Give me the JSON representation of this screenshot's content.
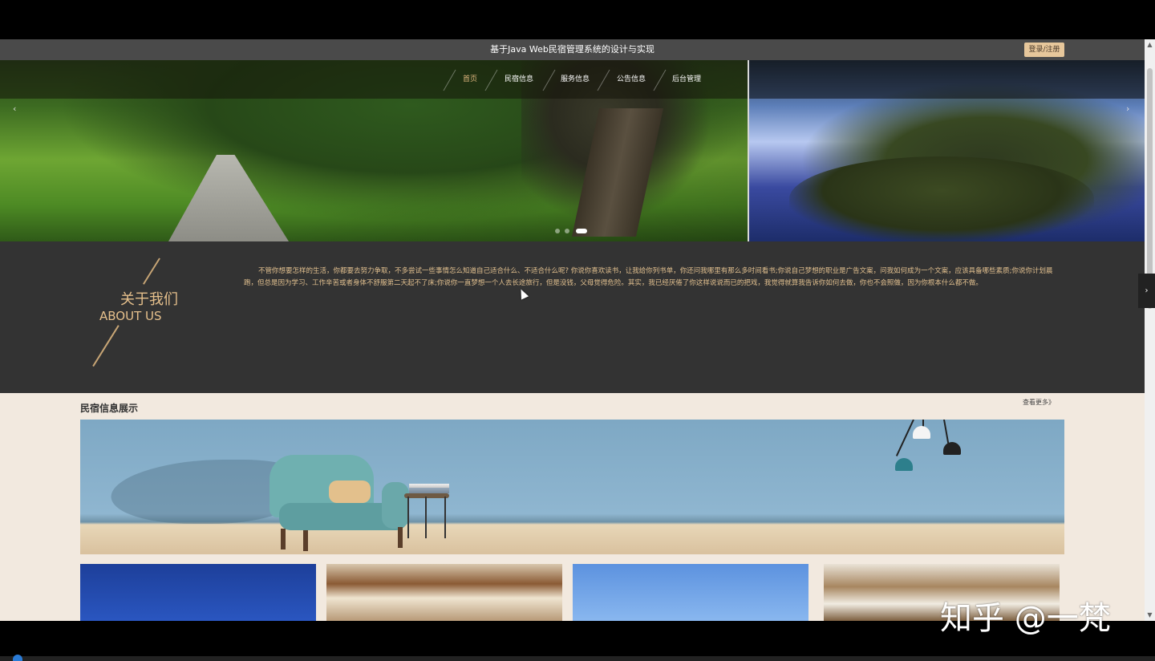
{
  "header": {
    "title": "基于Java Web民宿管理系统的设计与实现",
    "login_label": "登录/注册"
  },
  "nav": {
    "items": [
      {
        "label": "首页",
        "active": true
      },
      {
        "label": "民宿信息",
        "active": false
      },
      {
        "label": "服务信息",
        "active": false
      },
      {
        "label": "公告信息",
        "active": false
      },
      {
        "label": "后台管理",
        "active": false
      }
    ]
  },
  "carousel": {
    "prev_icon": "chevron-left-icon",
    "next_icon": "chevron-right-icon",
    "prev_glyph": "‹",
    "next_glyph": "›",
    "slide_count": 3,
    "active_index": 2
  },
  "about": {
    "title_cn": "关于我们",
    "title_en": "ABOUT US",
    "text": "不管你想要怎样的生活，你都要去努力争取，不多尝试一些事情怎么知道自己适合什么、不适合什么呢? 你说你喜欢读书，让我给你列书单，你还问我哪里有那么多时间看书;你说自己梦想的职业是广告文案，问我如何成为一个文案，应该具备哪些素质;你说你计划晨跑，但总是因为学习、工作辛苦或者身体不舒服第二天起不了床;你说你一直梦想一个人去长途旅行，但是没钱，父母觉得危险。其实，我已经厌倦了你这样说说而已的把戏，我觉得就算我告诉你如何去做，你也不会照做，因为你根本什么都不做。"
  },
  "side_tab": {
    "glyph": "›",
    "icon": "chevron-right-icon"
  },
  "section": {
    "title": "民宿信息展示",
    "more_label": "查看更多》"
  },
  "watermark": "知乎 @一梵",
  "colors": {
    "accent": "#e0b77f",
    "about_bg": "#333333",
    "page_bg": "#f2e9df",
    "topbar_bg": "#4a4a4a",
    "login_bg": "#e7c79b"
  }
}
